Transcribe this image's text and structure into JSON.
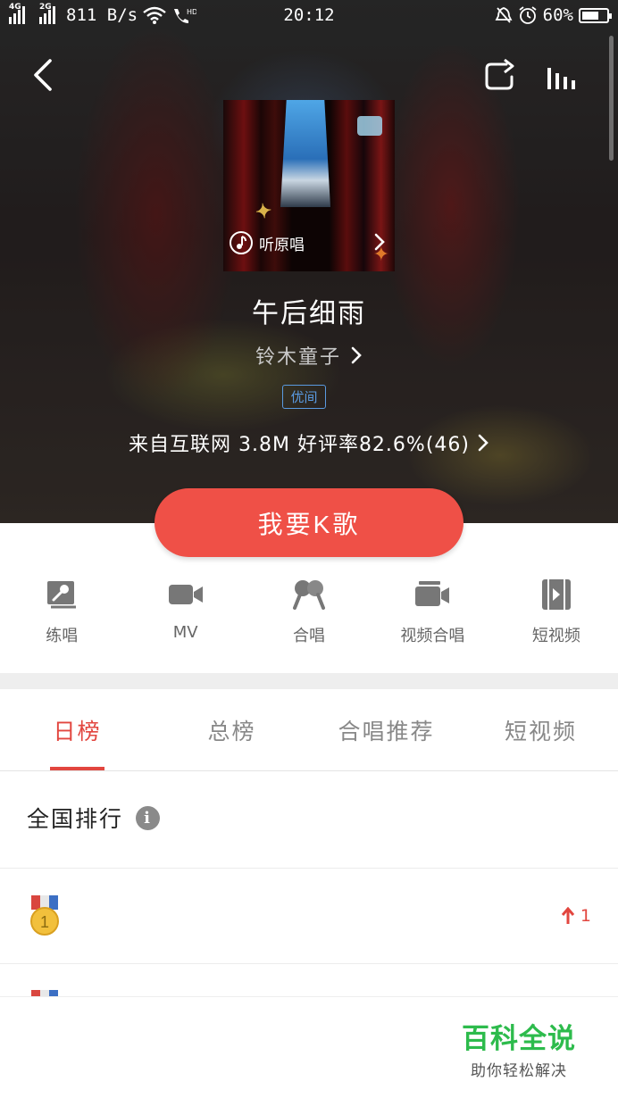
{
  "status_bar": {
    "net1": "4G",
    "net2": "2G",
    "speed": "811 B/s",
    "time": "20:12",
    "battery": "60%"
  },
  "song": {
    "cover_listen_label": "听原唱",
    "title": "午后细雨",
    "artist": "铃木童子",
    "quality_badge": "优间",
    "meta": "来自互联网 3.8M 好评率82.6%(46)"
  },
  "k_button": "我要K歌",
  "actions": [
    {
      "label": "练唱",
      "icon": "mic-card-icon"
    },
    {
      "label": "MV",
      "icon": "video-camera-icon"
    },
    {
      "label": "合唱",
      "icon": "duet-mic-icon"
    },
    {
      "label": "视频合唱",
      "icon": "video-duet-icon"
    },
    {
      "label": "短视频",
      "icon": "short-video-icon"
    }
  ],
  "tabs": [
    {
      "label": "日榜",
      "active": true
    },
    {
      "label": "总榜",
      "active": false
    },
    {
      "label": "合唱推荐",
      "active": false
    },
    {
      "label": "短视频",
      "active": false
    }
  ],
  "ranking": {
    "title": "全国排行",
    "info_symbol": "i",
    "rows": [
      {
        "rank": "1",
        "trend": "1"
      }
    ]
  },
  "watermark": {
    "title": "百科全说",
    "subtitle": "助你轻松解决"
  },
  "colors": {
    "accent": "#e2463f",
    "button": "#ef5047",
    "badge_blue": "#5a9ae0",
    "watermark_green": "#2dbb4c"
  }
}
